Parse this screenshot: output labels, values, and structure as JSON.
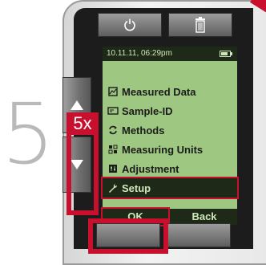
{
  "step": {
    "number": "5"
  },
  "badge": {
    "label": "5x"
  },
  "status": {
    "datetime": "10.11.11, 06:29pm",
    "battery_level": 0.75
  },
  "menu": {
    "items": [
      {
        "label": "Measured Data",
        "icon": "chart-icon"
      },
      {
        "label": "Sample-ID",
        "icon": "id-card-icon"
      },
      {
        "label": "Methods",
        "icon": "cycle-arrows-icon"
      },
      {
        "label": "Measuring Units",
        "icon": "units-icon"
      },
      {
        "label": "Adjustment",
        "icon": "adjust-icon"
      },
      {
        "label": "Setup",
        "icon": "wrench-icon",
        "selected": true
      }
    ]
  },
  "softkeys": {
    "ok": "OK",
    "back": "Back"
  },
  "colors": {
    "accent_red": "#c8102e",
    "screen_green": "#9ec781",
    "screen_dark": "#1e2a17"
  }
}
